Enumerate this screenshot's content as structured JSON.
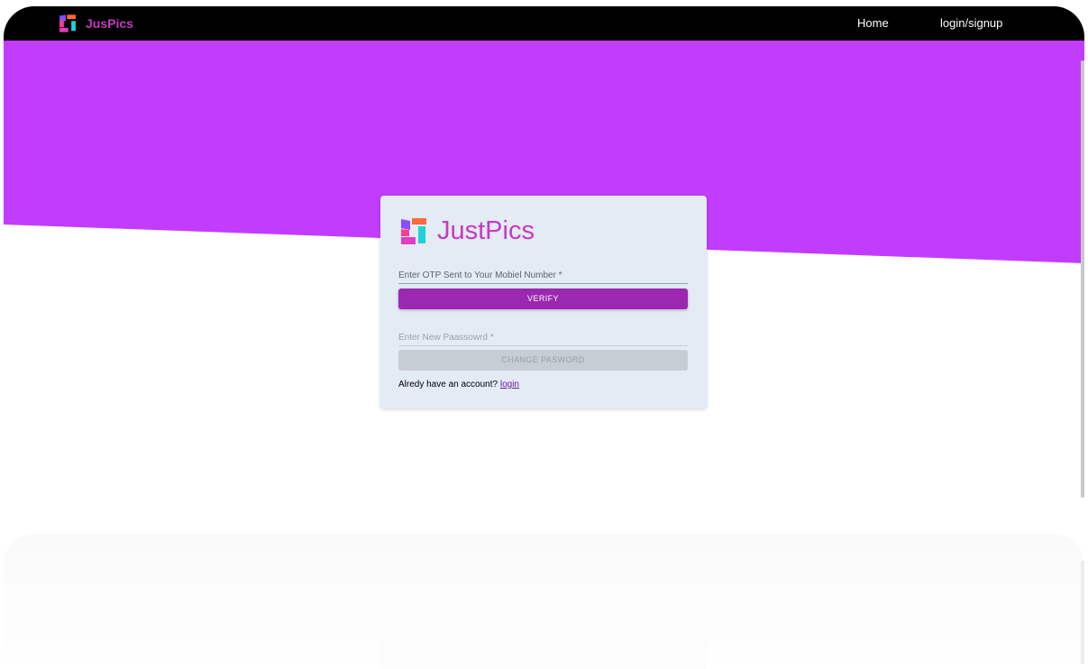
{
  "navbar": {
    "brand": "JusPics",
    "links": [
      {
        "label": "Home"
      },
      {
        "label": "login/signup"
      }
    ]
  },
  "card": {
    "brand": "JustPics",
    "otp_placeholder": "Enter OTP Sent to Your Mobiel Number *",
    "verify_label": "VERIFY",
    "password_placeholder": "Enter New Paassowrd *",
    "change_label": "CHANGE PASWORD",
    "footer_text": "Alredy have an account? ",
    "footer_link": "login"
  },
  "colors": {
    "hero_purple": "#c23cfe",
    "navbar": "#000000",
    "brand": "#c53ac4",
    "verify_button": "#9c27b0",
    "card_bg": "#e3ebf5"
  },
  "icons": {
    "logo": "justpics-pinwheel-logo-icon"
  }
}
